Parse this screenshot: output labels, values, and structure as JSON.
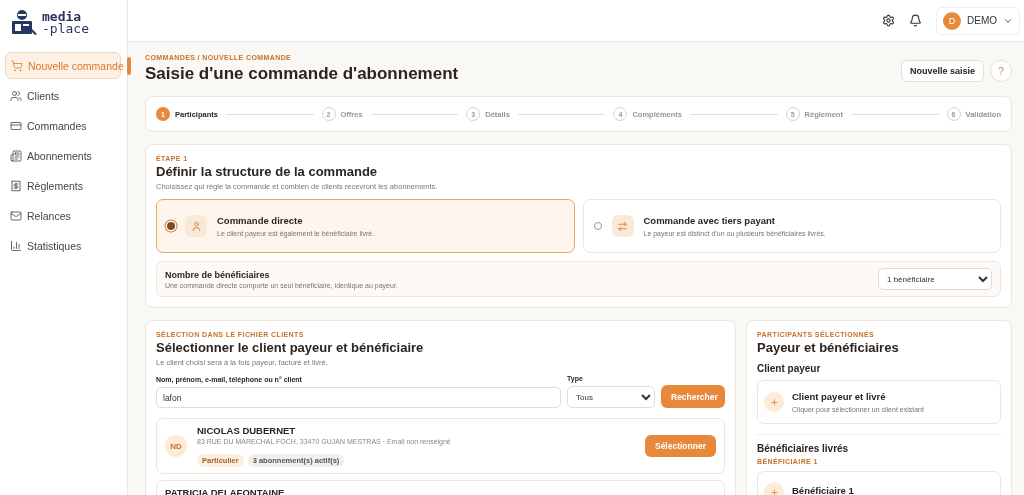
{
  "brand": {
    "line_1": "media",
    "line_2": "-place"
  },
  "sidebar": {
    "items": [
      {
        "label": "Nouvelle commande",
        "selected": true
      },
      {
        "label": "Clients",
        "selected": false
      },
      {
        "label": "Commandes",
        "selected": false
      },
      {
        "label": "Abonnements",
        "selected": false
      },
      {
        "label": "Règlements",
        "selected": false
      },
      {
        "label": "Relances",
        "selected": false
      },
      {
        "label": "Statistiques",
        "selected": false
      }
    ]
  },
  "topbar": {
    "user": {
      "initial": "D",
      "name": "DEMO"
    }
  },
  "header": {
    "breadcrumb": "COMMANDES / NOUVELLE COMMANDE",
    "title": "Saisie d'une commande d'abonnement",
    "primary_button": "Nouvelle saisie",
    "help_button": "?"
  },
  "stepper": [
    {
      "number": "1",
      "label": "Participants",
      "selected": true
    },
    {
      "number": "2",
      "label": "Offres",
      "selected": false
    },
    {
      "number": "3",
      "label": "Détails",
      "selected": false
    },
    {
      "number": "4",
      "label": "Compléments",
      "selected": false
    },
    {
      "number": "5",
      "label": "Règlement",
      "selected": false
    },
    {
      "number": "6",
      "label": "Validation",
      "selected": false
    }
  ],
  "structure": {
    "eyebrow": "ÉTAPE 1",
    "title": "Définir la structure de la commande",
    "description": "Choisissez qui règle la commande et combien de clients recevront les abonnements.",
    "options": [
      {
        "kind": "direct",
        "title": "Commande directe",
        "description": "Le client payeur est également le bénéficiaire livré.",
        "selected": true
      },
      {
        "kind": "third_party",
        "title": "Commande avec tiers payant",
        "description": "Le payeur est distinct d'un ou plusieurs bénéficiaires livrés.",
        "selected": false
      }
    ],
    "beneficiaries": {
      "label": "Nombre de bénéficiaires",
      "hint": "Une commande directe comporte un seul bénéficiaire, identique au payeur.",
      "value": "1 bénéficiaire"
    }
  },
  "client_search": {
    "eyebrow": "SÉLECTION DANS LE FICHIER CLIENTS",
    "title": "Sélectionner le client payeur et bénéficiaire",
    "description": "Le client choisi sera à la fois payeur, facturé et livré.",
    "query_label": "Nom, prénom, e-mail, téléphone ou n° client",
    "query_value": "lafon",
    "type_label": "Type",
    "type_value": "Tous",
    "search_button": "Rechercher",
    "results": [
      {
        "initials": "ND",
        "name": "NICOLAS DUBERNET",
        "details": "83 RUE DU MARECHAL FOCH, 33470 GUJAN MESTRAS · Email non renseigné",
        "tags": [
          {
            "kind": "type",
            "label": "Particulier"
          },
          {
            "kind": "count",
            "label": "3 abonnement(s) actif(s)"
          }
        ],
        "action": "Sélectionner"
      },
      {
        "name": "PATRICIA DELAFONTAINE"
      }
    ]
  },
  "participants": {
    "eyebrow": "PARTICIPANTS SÉLECTIONNÉS",
    "title": "Payeur et bénéficiaires",
    "payer_heading": "Client payeur",
    "payer_slot": {
      "title": "Client payeur et livré",
      "hint": "Cliquer pour sélectionner un client existant"
    },
    "beneficiaries_heading": "Bénéficiaires livrés",
    "beneficiary_label": "BÉNÉFICIAIRE 1",
    "beneficiary_slot": {
      "title": "Bénéficiaire 1"
    }
  }
}
